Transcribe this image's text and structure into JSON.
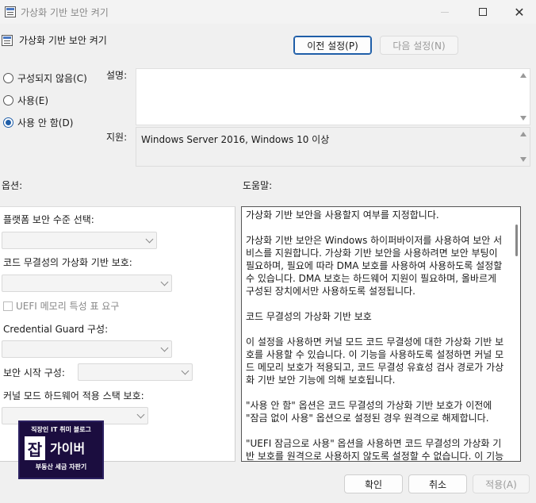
{
  "window": {
    "title": "가상화 기반 보안 켜기",
    "icon": "policy-icon",
    "controls": {
      "minimize": "minimize-icon",
      "maximize": "maximize-icon",
      "close": "✕"
    }
  },
  "header": {
    "policy_title": "가상화 기반 보안 켜기",
    "prev_button": "이전 설정(P)",
    "next_button": "다음 설정(N)"
  },
  "state": {
    "options": [
      {
        "label": "구성되지 않음(C)",
        "checked": false
      },
      {
        "label": "사용(E)",
        "checked": false
      },
      {
        "label": "사용 안 함(D)",
        "checked": true
      }
    ]
  },
  "comment": {
    "label": "설명:",
    "value": ""
  },
  "supported": {
    "label": "지원:",
    "value": "Windows Server 2016, Windows 10 이상"
  },
  "options_panel": {
    "header": "옵션:",
    "platform_label": "플랫폼 보안 수준 선택:",
    "platform_value": "",
    "code_integrity_label": "코드 무결성의 가상화 기반 보호:",
    "code_integrity_value": "",
    "uefi_checkbox": "UEFI 메모리 특성 표 요구",
    "credential_guard_label": "Credential  Guard 구성:",
    "credential_guard_value": "",
    "secure_launch_label": "보안 시작 구성:",
    "secure_launch_value": "",
    "kernel_stack_label": "커널 모드 하드웨어 적용 스택 보호:",
    "kernel_stack_value": ""
  },
  "help_panel": {
    "header": "도움말:",
    "text": "가상화 기반 보안을 사용할지 여부를 지정합니다.\n\n가상화 기반 보안은 Windows 하이퍼바이저를 사용하여 보안 서비스를 지원합니다. 가상화 기반 보안을 사용하려면 보안 부팅이 필요하며, 필요에 따라 DMA 보호를 사용하여 사용하도록 설정할 수 있습니다. DMA 보호는 하드웨어 지원이 필요하며, 올바르게 구성된 장치에서만 사용하도록 설정됩니다.\n\n코드 무결성의 가상화 기반 보호\n\n이 설정을 사용하면 커널 모드 코드 무결성에 대한 가상화 기반 보호를 사용할 수 있습니다. 이 기능을 사용하도록 설정하면 커널 모드 메모리 보호가 적용되고, 코드 무결성 유효성 검사 경로가 가상화 기반 보안 기능에 의해 보호됩니다.\n\n\"사용 안 함\" 옵션은 코드 무결성의 가상화 기반 보호가 이전에 \"잠금 없이 사용\" 옵션으로 설정된 경우 원격으로 해제합니다.\n\n\"UEFI 잠금으로 사용\" 옵션을 사용하면 코드 무결성의 가상화 기반 보호를 원격으로 사용하지 않도록 설정할 수 없습니다. 이 기능을 사용하지 않도록 설정하려면 그룹 정책 \"사용 안 함\"으로"
  },
  "footer": {
    "ok": "확인",
    "cancel": "취소",
    "apply": "적용(A)"
  },
  "watermark": {
    "top": "직장인 IT 취미 블로그",
    "mark": "잡",
    "name": "가이버",
    "bottom": "부동산 세금 자판기"
  },
  "colors": {
    "accent": "#1f5ea8",
    "watermark_bg": "#1b0d3f"
  }
}
